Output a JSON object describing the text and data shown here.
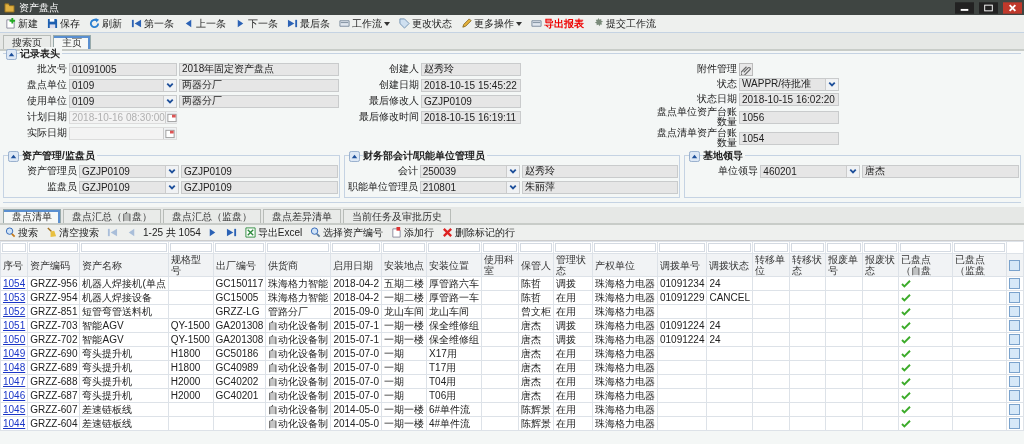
{
  "window": {
    "title": "资产盘点"
  },
  "toolbar": [
    {
      "label": "新建",
      "kind": "new",
      "dropdown": false,
      "highlight": false
    },
    {
      "label": "保存",
      "kind": "save",
      "dropdown": false,
      "highlight": false
    },
    {
      "label": "刷新",
      "kind": "refresh",
      "dropdown": false,
      "highlight": false
    },
    {
      "label": "第一条",
      "kind": "first",
      "dropdown": false,
      "highlight": false
    },
    {
      "label": "上一条",
      "kind": "prev",
      "dropdown": false,
      "highlight": false
    },
    {
      "label": "下一条",
      "kind": "next",
      "dropdown": false,
      "highlight": false
    },
    {
      "label": "最后条",
      "kind": "last",
      "dropdown": false,
      "highlight": false
    },
    {
      "label": "工作流",
      "kind": "workflow",
      "dropdown": true,
      "highlight": false
    },
    {
      "label": "更改状态",
      "kind": "status",
      "dropdown": false,
      "highlight": false
    },
    {
      "label": "更多操作",
      "kind": "more",
      "dropdown": true,
      "highlight": false
    },
    {
      "label": "导出报表",
      "kind": "export",
      "dropdown": false,
      "highlight": true
    },
    {
      "label": "提交工作流",
      "kind": "submit",
      "dropdown": false,
      "highlight": false
    }
  ],
  "page_tabs": [
    {
      "label": "搜索页",
      "selected": false
    },
    {
      "label": "主页",
      "selected": true
    }
  ],
  "record": {
    "title": "记录表头",
    "columns": [
      [
        {
          "label": "批次号",
          "value": "01091005",
          "desc": "2018年固定资产盘点",
          "kind": "text",
          "disabled": false
        },
        {
          "label": "盘点单位",
          "value": "0109",
          "desc": "两器分厂",
          "kind": "lookup",
          "disabled": false
        },
        {
          "label": "使用单位",
          "value": "0109",
          "desc": "两器分厂",
          "kind": "lookup",
          "disabled": false
        },
        {
          "label": "计划日期",
          "value": "2018-10-16 08:30:00",
          "kind": "date",
          "disabled": true
        },
        {
          "label": "实际日期",
          "kind": "date",
          "disabled": true
        }
      ],
      [
        {
          "label": "创建人",
          "value": "赵秀玲",
          "kind": "text",
          "disabled": false
        },
        {
          "label": "创建日期",
          "value": "2018-10-15 15:45:22",
          "kind": "text",
          "disabled": false
        },
        {
          "label": "最后修改人",
          "value": "GZJP0109",
          "kind": "text",
          "disabled": false
        },
        {
          "label": "最后修改时间",
          "value": "2018-10-15 16:19:11",
          "kind": "text",
          "disabled": false
        }
      ],
      [
        {
          "label": "附件管理",
          "kind": "attach",
          "disabled": false
        },
        {
          "label": "状态",
          "value": "WAPPR/待批准",
          "kind": "lookup",
          "disabled": false
        },
        {
          "label": "状态日期",
          "value": "2018-10-15 16:02:20",
          "kind": "text",
          "disabled": false
        },
        {
          "label": "盘点单位资产台账数量",
          "value": "1056",
          "kind": "text",
          "disabled": false
        },
        {
          "label": "盘点清单资产台账数量",
          "value": "1054",
          "kind": "text",
          "disabled": false
        }
      ]
    ]
  },
  "sections": [
    {
      "title": "资产管理/监盘员",
      "rows": [
        {
          "label": "资产管理员",
          "value": "GZJP0109",
          "desc": "GZJP0109"
        },
        {
          "label": "监盘员",
          "value": "GZJP0109",
          "desc": "GZJP0109"
        }
      ]
    },
    {
      "title": "财务部会计/职能单位管理员",
      "rows": [
        {
          "label": "会计",
          "value": "250039",
          "desc": "赵秀玲"
        },
        {
          "label": "职能单位管理员",
          "value": "210801",
          "desc": "朱丽萍"
        }
      ]
    },
    {
      "title": "基地领导",
      "rows": [
        {
          "label": "单位领导",
          "value": "460201",
          "desc": "唐杰"
        }
      ]
    }
  ],
  "detail_tabs": [
    {
      "label": "盘点清单",
      "selected": true
    },
    {
      "label": "盘点汇总（自盘）",
      "selected": false
    },
    {
      "label": "盘点汇总（监盘）",
      "selected": false
    },
    {
      "label": "盘点差异清单",
      "selected": false
    },
    {
      "label": "当前任务及审批历史",
      "selected": false
    }
  ],
  "grid_toolbar": [
    {
      "label": "搜索",
      "kind": "search"
    },
    {
      "label": "清空搜索",
      "kind": "clear"
    },
    {
      "kind": "first",
      "disabled": true
    },
    {
      "kind": "prev",
      "disabled": true
    },
    {
      "label": "1-25 共 1054",
      "kind": "pager"
    },
    {
      "kind": "next",
      "disabled": false
    },
    {
      "kind": "last",
      "disabled": false
    },
    {
      "label": "导出Excel",
      "kind": "excel"
    },
    {
      "label": "选择资产编号",
      "kind": "select"
    },
    {
      "label": "添加行",
      "kind": "add"
    },
    {
      "label": "删除标记的行",
      "kind": "delete"
    }
  ],
  "table": {
    "all_marked": false,
    "columns": [
      {
        "label": "序号",
        "kind": "link"
      },
      {
        "label": "资产编码",
        "kind": "text"
      },
      {
        "label": "资产名称",
        "kind": "text"
      },
      {
        "label": "规格型号",
        "kind": "text"
      },
      {
        "label": "出厂编号",
        "kind": "text"
      },
      {
        "label": "供货商",
        "kind": "text"
      },
      {
        "label": "启用日期",
        "kind": "text"
      },
      {
        "label": "安装地点",
        "kind": "text"
      },
      {
        "label": "安装位置",
        "kind": "text"
      },
      {
        "label": "使用科室",
        "kind": "text"
      },
      {
        "label": "保管人",
        "kind": "text"
      },
      {
        "label": "管理状态",
        "kind": "text"
      },
      {
        "label": "产权单位",
        "kind": "text"
      },
      {
        "label": "调拨单号",
        "kind": "text"
      },
      {
        "label": "调拨状态",
        "kind": "text"
      },
      {
        "label": "转移单位",
        "kind": "text"
      },
      {
        "label": "转移状态",
        "kind": "text"
      },
      {
        "label": "报废单号",
        "kind": "text"
      },
      {
        "label": "报废状态",
        "kind": "text"
      },
      {
        "label": "已盘点（自盘",
        "kind": "check"
      },
      {
        "label": "已盘点（监盘",
        "kind": "check"
      }
    ],
    "rows": [
      {
        "cells": [
          "1054",
          "GRZZ-956",
          "机器人焊接机(单点",
          "",
          "GC150117",
          "珠海格力智能",
          "2018-04-2",
          "五期二楼",
          "厚管路六车",
          "",
          "陈哲",
          "调拨",
          "珠海格力电器",
          "01091234",
          "24",
          "",
          "",
          "",
          "",
          true,
          false
        ],
        "marked": false
      },
      {
        "cells": [
          "1053",
          "GRZZ-954",
          "机器人焊接设备",
          "",
          "GC15005",
          "珠海格力智能",
          "2018-04-2",
          "一期二楼",
          "厚管路一车",
          "",
          "陈哲",
          "在用",
          "珠海格力电器",
          "01091229",
          "CANCEL",
          "",
          "",
          "",
          "",
          true,
          false
        ],
        "marked": false
      },
      {
        "cells": [
          "1052",
          "GRZZ-851",
          "短管弯管送料机",
          "",
          "GRZZ-LG",
          "管路分厂",
          "2015-09-0",
          "龙山车间",
          "龙山车间",
          "",
          "曾文柜",
          "在用",
          "珠海格力电器",
          "",
          "",
          "",
          "",
          "",
          "",
          true,
          false
        ],
        "marked": false
      },
      {
        "cells": [
          "1051",
          "GRZZ-703",
          "智能AGV",
          "QY-1500",
          "GA201308",
          "自动化设备制",
          "2015-07-1",
          "一期一楼",
          "保全维修组",
          "",
          "唐杰",
          "调拨",
          "珠海格力电器",
          "01091224",
          "24",
          "",
          "",
          "",
          "",
          true,
          false
        ],
        "marked": false
      },
      {
        "cells": [
          "1050",
          "GRZZ-702",
          "智能AGV",
          "QY-1500",
          "GA201308",
          "自动化设备制",
          "2015-07-1",
          "一期一楼",
          "保全维修组",
          "",
          "唐杰",
          "调拨",
          "珠海格力电器",
          "01091224",
          "24",
          "",
          "",
          "",
          "",
          true,
          false
        ],
        "marked": false
      },
      {
        "cells": [
          "1049",
          "GRZZ-690",
          "弯头提升机",
          "H1800",
          "GC50186",
          "自动化设备制",
          "2015-07-0",
          "一期",
          "X17用",
          "",
          "唐杰",
          "在用",
          "珠海格力电器",
          "",
          "",
          "",
          "",
          "",
          "",
          true,
          false
        ],
        "marked": false
      },
      {
        "cells": [
          "1048",
          "GRZZ-689",
          "弯头提升机",
          "H1800",
          "GC40989",
          "自动化设备制",
          "2015-07-0",
          "一期",
          "T17用",
          "",
          "唐杰",
          "在用",
          "珠海格力电器",
          "",
          "",
          "",
          "",
          "",
          "",
          true,
          false
        ],
        "marked": false
      },
      {
        "cells": [
          "1047",
          "GRZZ-688",
          "弯头提升机",
          "H2000",
          "GC40202",
          "自动化设备制",
          "2015-07-0",
          "一期",
          "T04用",
          "",
          "唐杰",
          "在用",
          "珠海格力电器",
          "",
          "",
          "",
          "",
          "",
          "",
          true,
          false
        ],
        "marked": false
      },
      {
        "cells": [
          "1046",
          "GRZZ-687",
          "弯头提升机",
          "H2000",
          "GC40201",
          "自动化设备制",
          "2015-07-0",
          "一期",
          "T06用",
          "",
          "唐杰",
          "在用",
          "珠海格力电器",
          "",
          "",
          "",
          "",
          "",
          "",
          true,
          false
        ],
        "marked": false
      },
      {
        "cells": [
          "1045",
          "GRZZ-607",
          "差速链板线",
          "",
          "",
          "自动化设备制",
          "2014-05-0",
          "一期一楼",
          "6#单件流",
          "",
          "陈辉景",
          "在用",
          "珠海格力电器",
          "",
          "",
          "",
          "",
          "",
          "",
          true,
          false
        ],
        "marked": false
      },
      {
        "cells": [
          "1044",
          "GRZZ-604",
          "差速链板线",
          "",
          "",
          "自动化设备制",
          "2014-05-0",
          "一期一楼",
          "4#单件流",
          "",
          "陈辉景",
          "在用",
          "珠海格力电器",
          "",
          "",
          "",
          "",
          "",
          "",
          true,
          false
        ],
        "marked": false
      }
    ]
  }
}
